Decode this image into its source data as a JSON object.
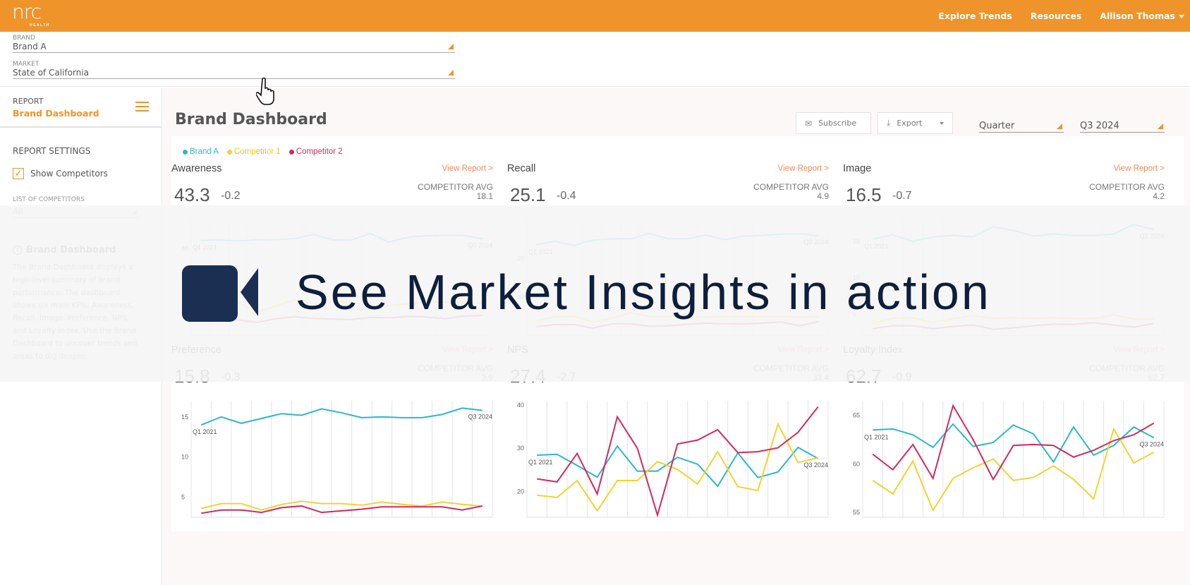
{
  "header": {
    "logo": "nrc",
    "logo_sub": "HEALTH",
    "nav": [
      "Explore Trends",
      "Resources"
    ],
    "user": "Allison Thomas",
    "brand_color": "#ef942a"
  },
  "filters": {
    "brand_label": "BRAND",
    "brand_value": "Brand A",
    "market_label": "MARKET",
    "market_value": "State of California"
  },
  "sidebar": {
    "report_label": "REPORT",
    "report_value": "Brand Dashboard",
    "settings_title": "REPORT SETTINGS",
    "show_competitors_label": "Show Competitors",
    "show_competitors_checked": true,
    "competitors_list_label": "LIST OF COMPETITORS",
    "competitors_list_value": "All",
    "info_title": "Brand Dashboard",
    "info_text": "The Brand Dashboard displays a high-level summary of brand performance. The dashboard shows six main KPIs: Awareness, Recall, Image, Preference, NPS, and Loyalty Index. Use the Brand Dashboard to uncover trends and areas to dig deeper."
  },
  "main": {
    "title": "Brand Dashboard",
    "subscribe_label": "Subscribe",
    "export_label": "Export",
    "period_type": "Quarter",
    "period_value": "Q3 2024",
    "view_report_label": "View Report >",
    "competitor_avg_label": "COMPETITOR AVG"
  },
  "overlay": {
    "cta_text": "See Market Insights in action"
  },
  "chart_data": [
    {
      "type": "line",
      "title": "Awareness",
      "kpi": "43.3",
      "delta": "-0.2",
      "competitor_avg": "18.1",
      "x_start_label": "Q1 2021",
      "x_end_label": "Q3 2024",
      "ylim": [
        10,
        50
      ],
      "yticks": [
        20,
        40
      ],
      "legend": [
        "Brand A",
        "Competitor 1",
        "Competitor 2"
      ],
      "colors": [
        "#2bb7cf",
        "#f5d130",
        "#d22a5e"
      ],
      "series": [
        {
          "name": "Brand A",
          "values": [
            42.8,
            42.9,
            42.6,
            43.0,
            43.1,
            43.4,
            44.9,
            43.0,
            42.9,
            45.2,
            42.2,
            43.9,
            44.4,
            44.6,
            44.5,
            43.3
          ]
        },
        {
          "name": "Competitor 1",
          "values": [
            19.6,
            21.7,
            21.6,
            18.2,
            20.3,
            22.4,
            21.0,
            21.8,
            21.4,
            20.5,
            20.4,
            21.0,
            21.6,
            21.6,
            21.3,
            21.2
          ]
        },
        {
          "name": "Competitor 2",
          "values": [
            15.2,
            15.8,
            15.5,
            14.6,
            15.9,
            16.6,
            16.0,
            15.8,
            15.6,
            16.3,
            16.2,
            16.7,
            16.5,
            15.9,
            16.8,
            17.0
          ]
        }
      ]
    },
    {
      "type": "line",
      "title": "Recall",
      "kpi": "25.1",
      "delta": "-0.4",
      "competitor_avg": "4.9",
      "x_start_label": "Q1 2021",
      "x_end_label": "Q3 2024",
      "ylim": [
        0,
        30
      ],
      "yticks": [
        10,
        20
      ],
      "series": [
        {
          "name": "Brand A",
          "values": [
            23.5,
            24.4,
            23.3,
            24.7,
            25.0,
            25.0,
            26.4,
            25.0,
            25.0,
            26.0,
            24.8,
            25.7,
            25.9,
            26.2,
            26.3,
            25.8
          ]
        },
        {
          "name": "Competitor 1",
          "values": [
            3.9,
            4.9,
            5.1,
            3.5,
            4.5,
            6.0,
            5.0,
            5.0,
            4.9,
            4.8,
            5.0,
            5.0,
            5.0,
            5.0,
            4.8,
            4.9
          ]
        },
        {
          "name": "Competitor 2",
          "values": [
            2.4,
            2.9,
            2.9,
            2.0,
            3.1,
            3.1,
            2.5,
            2.6,
            3.0,
            3.3,
            3.1,
            3.1,
            3.3,
            3.6,
            2.6,
            3.7
          ]
        }
      ]
    },
    {
      "type": "line",
      "title": "Image",
      "kpi": "16.5",
      "delta": "-0.7",
      "competitor_avg": "4.2",
      "x_start_label": "Q1 2021",
      "x_end_label": "Q3 2024",
      "ylim": [
        2,
        18
      ],
      "yticks": [
        5,
        10,
        15
      ],
      "series": [
        {
          "name": "Brand A",
          "values": [
            15.3,
            15.9,
            15.0,
            15.6,
            15.8,
            15.6,
            17.0,
            16.5,
            15.7,
            16.0,
            15.8,
            15.8,
            16.0,
            17.3,
            16.6
          ]
        },
        {
          "name": "Competitor 1",
          "values": [
            3.8,
            4.4,
            4.5,
            3.8,
            4.4,
            4.8,
            4.4,
            4.5,
            4.4,
            4.5,
            4.4,
            4.4,
            4.9,
            4.3,
            4.3
          ]
        },
        {
          "name": "Competitor 2",
          "values": [
            3.0,
            3.4,
            3.4,
            3.0,
            3.3,
            3.5,
            2.9,
            3.1,
            3.4,
            3.6,
            3.6,
            3.8,
            3.5,
            3.2,
            3.7
          ]
        }
      ]
    },
    {
      "type": "line",
      "title": "Preference",
      "kpi": "15.8",
      "delta": "-0.3",
      "competitor_avg": "3.9",
      "x_start_label": "Q1 2021",
      "x_end_label": "Q3 2024",
      "ylim": [
        2.5,
        17
      ],
      "yticks": [
        5,
        10,
        15
      ],
      "series": [
        {
          "name": "Brand A",
          "values": [
            14.0,
            15.0,
            14.2,
            14.8,
            15.4,
            15.2,
            16.0,
            15.5,
            14.9,
            15.0,
            14.9,
            14.9,
            15.3,
            16.1,
            15.8
          ]
        },
        {
          "name": "Competitor 1",
          "values": [
            3.6,
            4.2,
            4.2,
            3.4,
            4.1,
            4.5,
            4.2,
            4.2,
            4.0,
            4.4,
            4.1,
            3.9,
            4.4,
            4.1,
            3.9
          ]
        },
        {
          "name": "Competitor 2",
          "values": [
            3.0,
            3.4,
            3.4,
            3.1,
            3.7,
            3.9,
            3.1,
            3.3,
            3.5,
            3.8,
            3.8,
            3.8,
            3.8,
            3.4,
            3.9
          ]
        }
      ]
    },
    {
      "type": "line",
      "title": "NPS",
      "kpi": "27.4",
      "delta": "-2.7",
      "competitor_avg": "33.4",
      "x_start_label": "Q1 2021",
      "x_end_label": "Q3 2024",
      "ylim": [
        14,
        41
      ],
      "yticks": [
        20,
        30,
        40
      ],
      "series": [
        {
          "name": "Brand A",
          "values": [
            28.4,
            28.6,
            26.0,
            23.3,
            30.5,
            24.7,
            24.7,
            27.9,
            26.3,
            21.2,
            28.9,
            23.2,
            24.5,
            30.2,
            27.6
          ]
        },
        {
          "name": "Competitor 1",
          "values": [
            19.1,
            18.6,
            22.5,
            15.5,
            22.5,
            22.5,
            26.9,
            25.1,
            21.7,
            29.2,
            21.1,
            20.2,
            35.6,
            26.7,
            27.8
          ]
        },
        {
          "name": "Competitor 2",
          "values": [
            22.9,
            22.2,
            28.8,
            19.4,
            37.3,
            30.0,
            14.5,
            31.0,
            31.9,
            34.3,
            29.0,
            29.2,
            30.1,
            33.7,
            39.6
          ]
        }
      ]
    },
    {
      "type": "line",
      "title": "Loyalty Index",
      "kpi": "62.7",
      "delta": "-0.9",
      "competitor_avg": "62.7",
      "x_start_label": "Q1 2021",
      "x_end_label": "Q3 2024",
      "ylim": [
        54.5,
        66.5
      ],
      "yticks": [
        55,
        60,
        65
      ],
      "series": [
        {
          "name": "Brand A",
          "values": [
            63.5,
            63.6,
            63.0,
            61.7,
            64.1,
            61.8,
            62.2,
            64.0,
            63.1,
            60.2,
            63.8,
            60.9,
            61.9,
            63.8,
            62.7
          ]
        },
        {
          "name": "Competitor 1",
          "values": [
            58.3,
            56.9,
            60.3,
            55.2,
            58.5,
            59.6,
            60.5,
            58.3,
            58.6,
            59.8,
            58.4,
            56.4,
            63.6,
            60.1,
            61.2
          ]
        },
        {
          "name": "Competitor 2",
          "values": [
            61.0,
            59.4,
            62.0,
            58.5,
            66.0,
            62.5,
            58.4,
            61.9,
            62.0,
            61.9,
            60.7,
            61.4,
            62.4,
            63.0,
            64.2
          ]
        }
      ]
    }
  ]
}
